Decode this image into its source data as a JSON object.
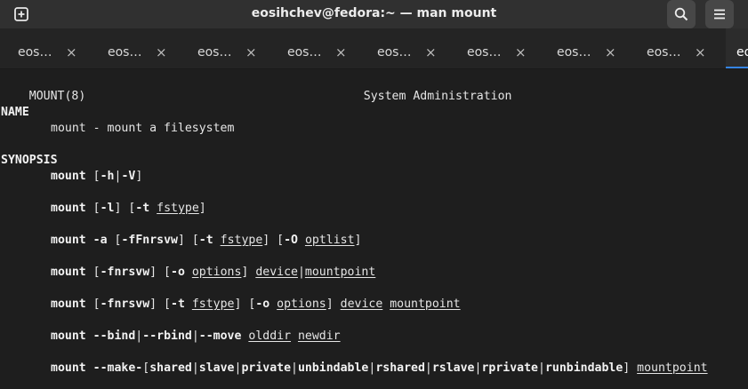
{
  "window": {
    "title": "eosihchev@fedora:~ — man mount"
  },
  "header": {
    "new_tab_icon": "new-tab-icon",
    "search_icon": "search-icon",
    "menu_icon": "hamburger-menu-icon"
  },
  "tabs": [
    {
      "label": "eos…",
      "close": "×",
      "active": false
    },
    {
      "label": "eos…",
      "close": "×",
      "active": false
    },
    {
      "label": "eos…",
      "close": "×",
      "active": false
    },
    {
      "label": "eos…",
      "close": "×",
      "active": false
    },
    {
      "label": "eos…",
      "close": "×",
      "active": false
    },
    {
      "label": "eos…",
      "close": "×",
      "active": false
    },
    {
      "label": "eos…",
      "close": "×",
      "active": false
    },
    {
      "label": "eos…",
      "close": "×",
      "active": false
    },
    {
      "label": "eo",
      "close": "",
      "active": true
    }
  ],
  "man": {
    "header_left": "MOUNT(8)",
    "header_center": "System Administration",
    "name_heading": "NAME",
    "name_text": "mount - mount a filesystem",
    "synopsis_heading": "SYNOPSIS",
    "synopsis": [
      [
        {
          "t": "mount",
          "s": "b"
        },
        {
          "t": " [",
          "s": ""
        },
        {
          "t": "-h",
          "s": "b"
        },
        {
          "t": "|",
          "s": ""
        },
        {
          "t": "-V",
          "s": "b"
        },
        {
          "t": "]",
          "s": ""
        }
      ],
      [
        {
          "t": "mount",
          "s": "b"
        },
        {
          "t": " [",
          "s": ""
        },
        {
          "t": "-l",
          "s": "b"
        },
        {
          "t": "] [",
          "s": ""
        },
        {
          "t": "-t",
          "s": "b"
        },
        {
          "t": " ",
          "s": ""
        },
        {
          "t": "fstype",
          "s": "u"
        },
        {
          "t": "]",
          "s": ""
        }
      ],
      [
        {
          "t": "mount",
          "s": "b"
        },
        {
          "t": " ",
          "s": ""
        },
        {
          "t": "-a",
          "s": "b"
        },
        {
          "t": " [",
          "s": ""
        },
        {
          "t": "-fFnrsvw",
          "s": "b"
        },
        {
          "t": "] [",
          "s": ""
        },
        {
          "t": "-t",
          "s": "b"
        },
        {
          "t": " ",
          "s": ""
        },
        {
          "t": "fstype",
          "s": "u"
        },
        {
          "t": "] [",
          "s": ""
        },
        {
          "t": "-O",
          "s": "b"
        },
        {
          "t": " ",
          "s": ""
        },
        {
          "t": "optlist",
          "s": "u"
        },
        {
          "t": "]",
          "s": ""
        }
      ],
      [
        {
          "t": "mount",
          "s": "b"
        },
        {
          "t": " [",
          "s": ""
        },
        {
          "t": "-fnrsvw",
          "s": "b"
        },
        {
          "t": "] [",
          "s": ""
        },
        {
          "t": "-o",
          "s": "b"
        },
        {
          "t": " ",
          "s": ""
        },
        {
          "t": "options",
          "s": "u"
        },
        {
          "t": "] ",
          "s": ""
        },
        {
          "t": "device",
          "s": "u"
        },
        {
          "t": "|",
          "s": ""
        },
        {
          "t": "mountpoint",
          "s": "u"
        }
      ],
      [
        {
          "t": "mount",
          "s": "b"
        },
        {
          "t": " [",
          "s": ""
        },
        {
          "t": "-fnrsvw",
          "s": "b"
        },
        {
          "t": "] [",
          "s": ""
        },
        {
          "t": "-t",
          "s": "b"
        },
        {
          "t": " ",
          "s": ""
        },
        {
          "t": "fstype",
          "s": "u"
        },
        {
          "t": "] [",
          "s": ""
        },
        {
          "t": "-o",
          "s": "b"
        },
        {
          "t": " ",
          "s": ""
        },
        {
          "t": "options",
          "s": "u"
        },
        {
          "t": "] ",
          "s": ""
        },
        {
          "t": "device",
          "s": "u"
        },
        {
          "t": " ",
          "s": ""
        },
        {
          "t": "mountpoint",
          "s": "u"
        }
      ],
      [
        {
          "t": "mount",
          "s": "b"
        },
        {
          "t": " ",
          "s": ""
        },
        {
          "t": "--bind",
          "s": "b"
        },
        {
          "t": "|",
          "s": ""
        },
        {
          "t": "--rbind",
          "s": "b"
        },
        {
          "t": "|",
          "s": ""
        },
        {
          "t": "--move",
          "s": "b"
        },
        {
          "t": " ",
          "s": ""
        },
        {
          "t": "olddir",
          "s": "u"
        },
        {
          "t": " ",
          "s": ""
        },
        {
          "t": "newdir",
          "s": "u"
        }
      ],
      [
        {
          "t": "mount",
          "s": "b"
        },
        {
          "t": " ",
          "s": ""
        },
        {
          "t": "--make-",
          "s": "b"
        },
        {
          "t": "[",
          "s": ""
        },
        {
          "t": "shared",
          "s": "b"
        },
        {
          "t": "|",
          "s": ""
        },
        {
          "t": "slave",
          "s": "b"
        },
        {
          "t": "|",
          "s": ""
        },
        {
          "t": "private",
          "s": "b"
        },
        {
          "t": "|",
          "s": ""
        },
        {
          "t": "unbindable",
          "s": "b"
        },
        {
          "t": "|",
          "s": ""
        },
        {
          "t": "rshared",
          "s": "b"
        },
        {
          "t": "|",
          "s": ""
        },
        {
          "t": "rslave",
          "s": "b"
        },
        {
          "t": "|",
          "s": ""
        },
        {
          "t": "rprivate",
          "s": "b"
        },
        {
          "t": "|",
          "s": ""
        },
        {
          "t": "runbindable",
          "s": "b"
        },
        {
          "t": "] ",
          "s": ""
        },
        {
          "t": "mountpoint",
          "s": "u"
        }
      ]
    ]
  },
  "colors": {
    "accent": "#3584e4",
    "terminal_bg": "#1e1e1e",
    "headerbar_bg": "#303030"
  }
}
